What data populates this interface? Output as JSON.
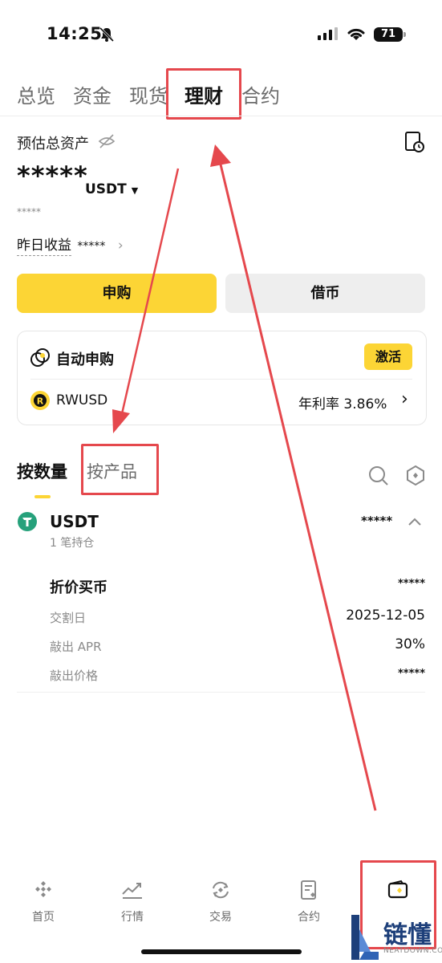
{
  "status": {
    "time": "14:25",
    "battery": "71"
  },
  "tabs": [
    {
      "label": "总览"
    },
    {
      "label": "资金"
    },
    {
      "label": "现货"
    },
    {
      "label": "理财"
    },
    {
      "label": "合约"
    }
  ],
  "assets": {
    "title": "预估总资产",
    "value": "*****",
    "currency": "USDT",
    "sub_value": "*****",
    "yesterday_label": "昨日收益",
    "yesterday_value": "*****"
  },
  "actions": {
    "subscribe": "申购",
    "borrow": "借币"
  },
  "auto_card": {
    "title": "自动申购",
    "activate": "激活",
    "coin": "RWUSD",
    "rate_label": "年利率 3.86%"
  },
  "sub_tabs": {
    "by_amount": "按数量",
    "by_product": "按产品"
  },
  "position": {
    "coin": "USDT",
    "count": "1 笔持仓",
    "amount": "*****",
    "product": "折价买币",
    "product_value": "*****",
    "rows": [
      {
        "label": "交割日",
        "value": "2025-12-05"
      },
      {
        "label": "敲出 APR",
        "value": "30%"
      },
      {
        "label": "敲出价格",
        "value": "*****"
      }
    ]
  },
  "bottom_nav": [
    {
      "label": "首页",
      "icon": "home-icon"
    },
    {
      "label": "行情",
      "icon": "market-icon"
    },
    {
      "label": "交易",
      "icon": "trade-icon"
    },
    {
      "label": "合约",
      "icon": "futures-icon"
    },
    {
      "label": "",
      "icon": "wallet-icon"
    }
  ],
  "watermark": {
    "text": "链懂",
    "sub": "NEATDOWN.COM"
  },
  "colors": {
    "accent": "#fcd535",
    "annotation": "#e5484d"
  }
}
